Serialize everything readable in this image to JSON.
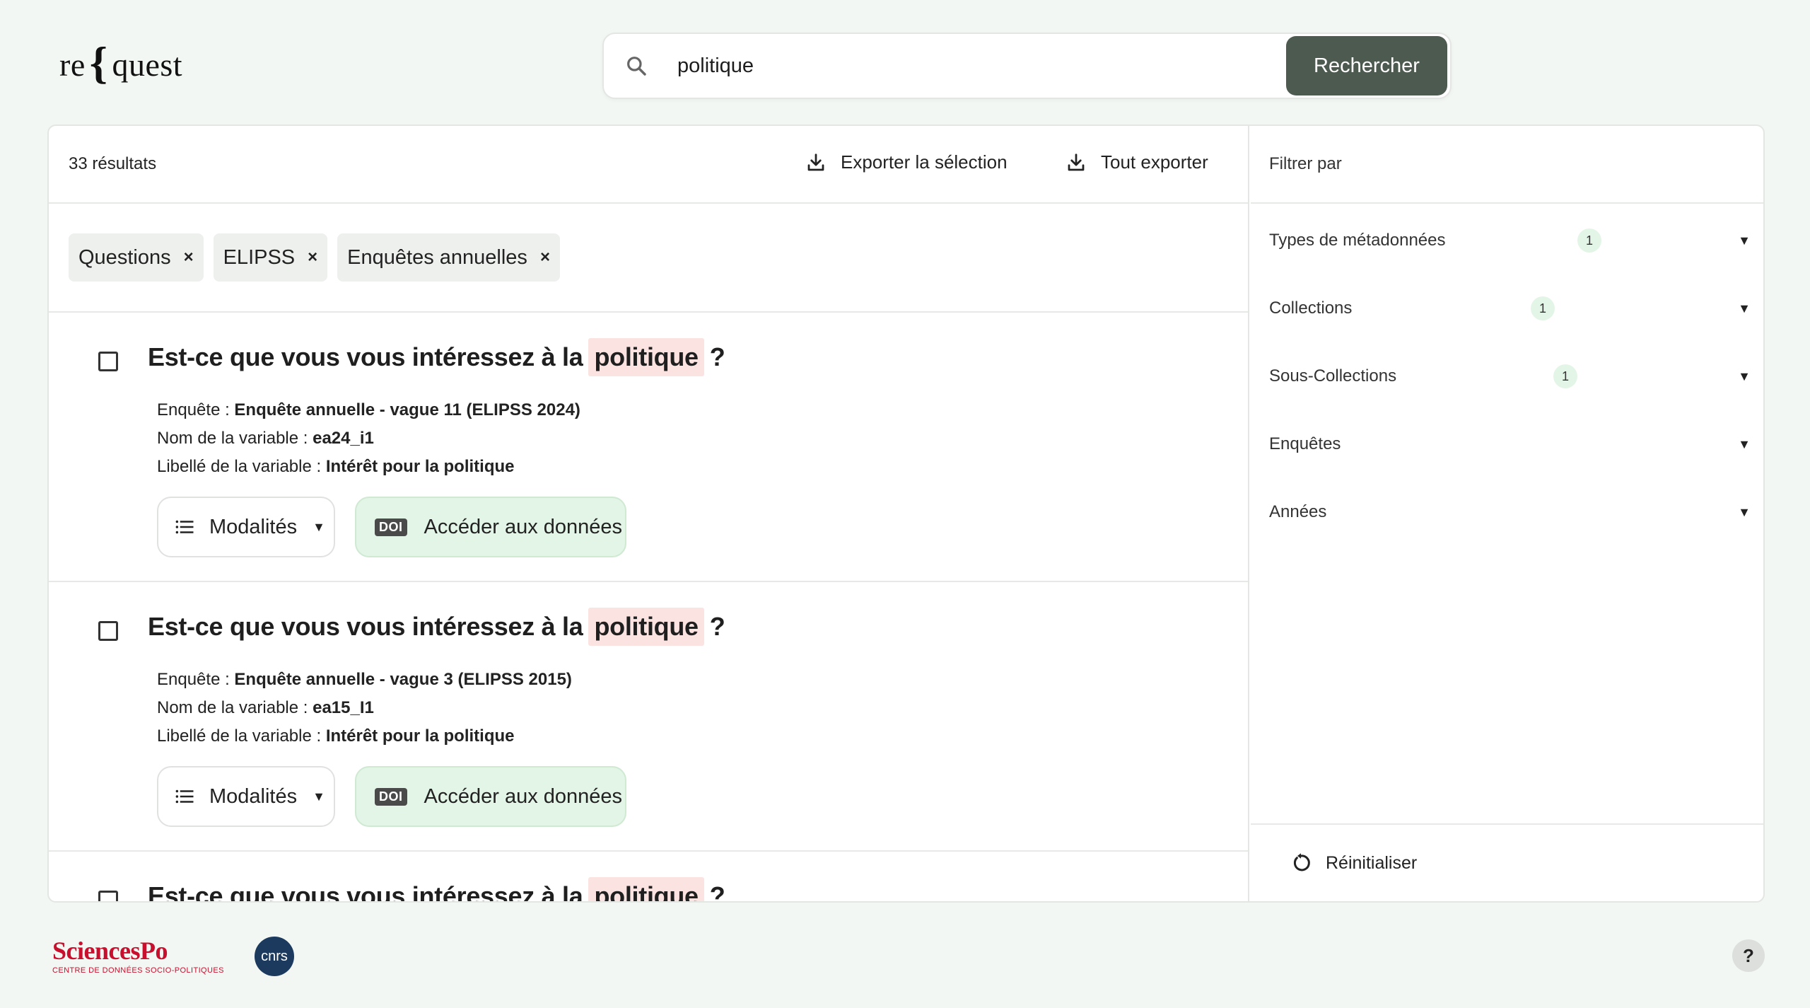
{
  "logo": {
    "left": "re",
    "brace": "{",
    "right": "quest"
  },
  "search": {
    "value": "politique",
    "button_label": "Rechercher"
  },
  "results": {
    "count_label": "33 résultats",
    "export_selection_label": "Exporter la sélection",
    "export_all_label": "Tout exporter",
    "chips": [
      "Questions",
      "ELIPSS",
      "Enquêtes annuelles"
    ],
    "chip_remove": "×",
    "items": [
      {
        "title_before": "Est-ce que vous vous intéressez à la",
        "title_highlight": "politique",
        "title_after": "?",
        "survey_label": "Enquête :",
        "survey_value": "Enquête annuelle - vague 11 (ELIPSS 2024)",
        "varname_label": "Nom de la variable :",
        "varname_value": "ea24_i1",
        "varlabel_label": "Libellé de la variable :",
        "varlabel_value": "Intérêt pour la politique",
        "modalities_label": "Modalités",
        "doi_badge": "DOI",
        "access_label": "Accéder aux données"
      },
      {
        "title_before": "Est-ce que vous vous intéressez à la",
        "title_highlight": "politique",
        "title_after": "?",
        "survey_label": "Enquête :",
        "survey_value": "Enquête annuelle - vague 3 (ELIPSS 2015)",
        "varname_label": "Nom de la variable :",
        "varname_value": "ea15_I1",
        "varlabel_label": "Libellé de la variable :",
        "varlabel_value": "Intérêt pour la politique",
        "modalities_label": "Modalités",
        "doi_badge": "DOI",
        "access_label": "Accéder aux données"
      },
      {
        "title_before": "Est-ce que vous vous intéressez à la",
        "title_highlight": "politique",
        "title_after": "?"
      }
    ]
  },
  "filters": {
    "header": "Filtrer par",
    "items": [
      {
        "label": "Types de métadonnées",
        "count": "1"
      },
      {
        "label": "Collections",
        "count": "1"
      },
      {
        "label": "Sous-Collections",
        "count": "1"
      },
      {
        "label": "Enquêtes",
        "count": ""
      },
      {
        "label": "Années",
        "count": ""
      }
    ],
    "reset_label": "Réinitialiser"
  },
  "footer": {
    "sciencespo_name": "SciencesPo",
    "sciencespo_sub": "CENTRE DE DONNÉES SOCIO-POLITIQUES",
    "cnrs": "cnrs",
    "help": "?"
  },
  "colors": {
    "accent": "#4d5a50",
    "highlight": "#fbe3e2",
    "doi_bg": "#e3f5e6",
    "brand_red": "#c8102e"
  }
}
